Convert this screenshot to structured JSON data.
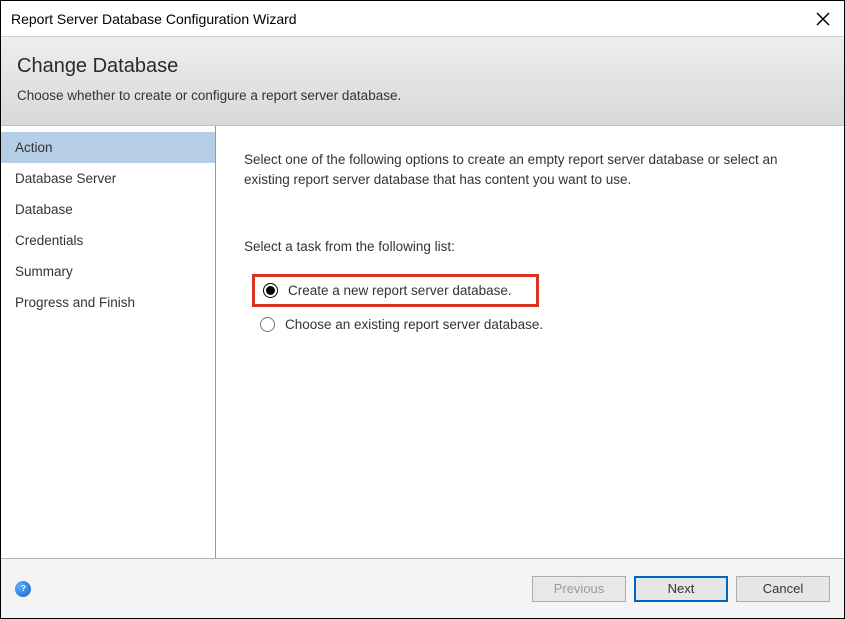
{
  "window": {
    "title": "Report Server Database Configuration Wizard"
  },
  "header": {
    "title": "Change Database",
    "subtitle": "Choose whether to create or configure a report server database."
  },
  "sidebar": {
    "items": [
      {
        "label": "Action"
      },
      {
        "label": "Database Server"
      },
      {
        "label": "Database"
      },
      {
        "label": "Credentials"
      },
      {
        "label": "Summary"
      },
      {
        "label": "Progress and Finish"
      }
    ]
  },
  "content": {
    "intro": "Select one of the following options to create an empty report server database or select an existing report server database that has content you want to use.",
    "task_label": "Select a task from the following list:",
    "options": {
      "create": "Create a new report server database.",
      "choose": "Choose an existing report server database."
    }
  },
  "footer": {
    "previous": "Previous",
    "next": "Next",
    "cancel": "Cancel"
  }
}
